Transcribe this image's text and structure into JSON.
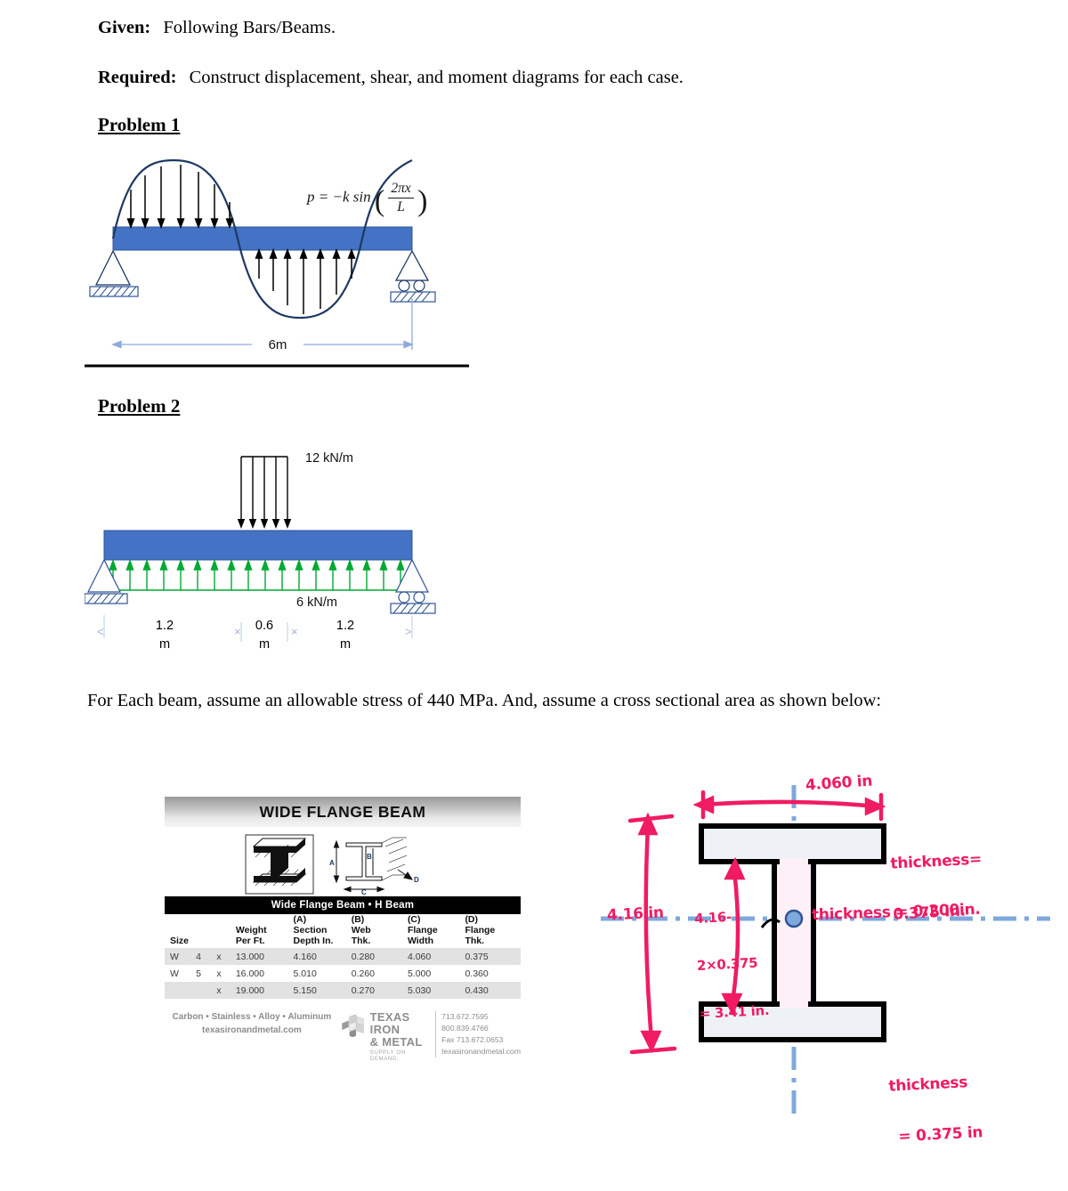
{
  "doc": {
    "given_label": "Given:",
    "given_text": "Following Bars/Beams.",
    "required_label": "Required:",
    "required_text": "Construct displacement, shear, and moment diagrams for each case.",
    "problem1_heading": "Problem 1",
    "problem2_heading": "Problem 2",
    "note_text": "For Each beam, assume an allowable stress of 440 MPa.  And, assume a cross sectional area as shown below:"
  },
  "problem1": {
    "equation": "p = −k sin(2πx/L)",
    "equation_lhs": "p = −k sin",
    "equation_num": "2πx",
    "equation_den": "L",
    "span_label": "6m",
    "left_support": "pin-support",
    "right_support": "roller-support",
    "beam_color": "#4472c4",
    "curve_color": "#1f3864"
  },
  "problem2": {
    "top_load_label": "12 kN/m",
    "bottom_load_label": "6 kN/m",
    "dim1": "1.2",
    "dim1_unit": "m",
    "dim2": "0.6",
    "dim2_unit": "m",
    "dim3": "1.2",
    "dim3_unit": "m",
    "beam_color": "#4472c4",
    "uplift_color": "#00a933"
  },
  "catalog": {
    "title": "WIDE FLANGE BEAM",
    "subtitle": "Wide Flange Beam • H Beam",
    "dim_labels": [
      "A",
      "B",
      "C",
      "D"
    ],
    "headers": {
      "size": "Size",
      "weight": [
        "Weight",
        "Per Ft."
      ],
      "a": [
        "(A)",
        "Section",
        "Depth In."
      ],
      "b": [
        "(B)",
        "Web",
        "Thk."
      ],
      "c": [
        "(C)",
        "Flange",
        "Width"
      ],
      "d": [
        "(D)",
        "Flange",
        "Thk."
      ]
    },
    "rows": [
      {
        "size": "W",
        "n": "4",
        "x": "x",
        "weight": "13.000",
        "depth": "4.160",
        "web": "0.280",
        "fwidth": "4.060",
        "fthk": "0.375"
      },
      {
        "size": "W",
        "n": "5",
        "x": "x",
        "weight": "16.000",
        "depth": "5.010",
        "web": "0.260",
        "fwidth": "5.000",
        "fthk": "0.360"
      },
      {
        "size": "",
        "n": "",
        "x": "x",
        "weight": "19.000",
        "depth": "5.150",
        "web": "0.270",
        "fwidth": "5.030",
        "fthk": "0.430"
      }
    ],
    "footer": {
      "materials": "Carbon • Stainless • Alloy • Aluminum",
      "website": "texasironandmetal.com",
      "company_line1": "TEXAS IRON",
      "company_line2": "& METAL",
      "tagline": "SUPPLY ON DEMAND.",
      "phone1": "713.672.7595",
      "phone2": "800.839.4766",
      "fax": "Fax 713.672.0653",
      "url": "texasironandmetal.com"
    }
  },
  "annotations": {
    "flange_width": "4.060 in",
    "total_depth": "4.16 in",
    "top_flange_thk_l1": "thickness=",
    "top_flange_thk_l2": "0.375 in.",
    "web_calc_l1": "4.16-",
    "web_calc_l2": "2×0.375",
    "web_calc_l3": "= 3.41 in.",
    "web_thk": "thickness = 0.200in.",
    "bot_flange_thk_l1": "thickness",
    "bot_flange_thk_l2": "= 0.375 in",
    "ink_color": "#f01b63"
  }
}
